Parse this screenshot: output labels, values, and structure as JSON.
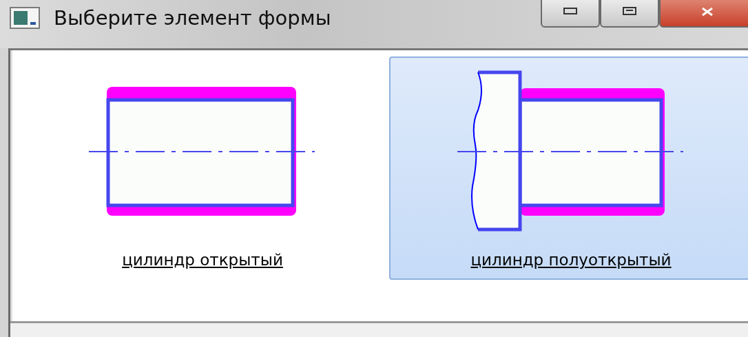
{
  "window": {
    "title": "Выберите элемент формы"
  },
  "items": [
    {
      "label": "цилиндр открытый",
      "kind": "open",
      "selected": false
    },
    {
      "label": "цилиндр полуоткрытый",
      "kind": "half-open",
      "selected": true
    }
  ]
}
